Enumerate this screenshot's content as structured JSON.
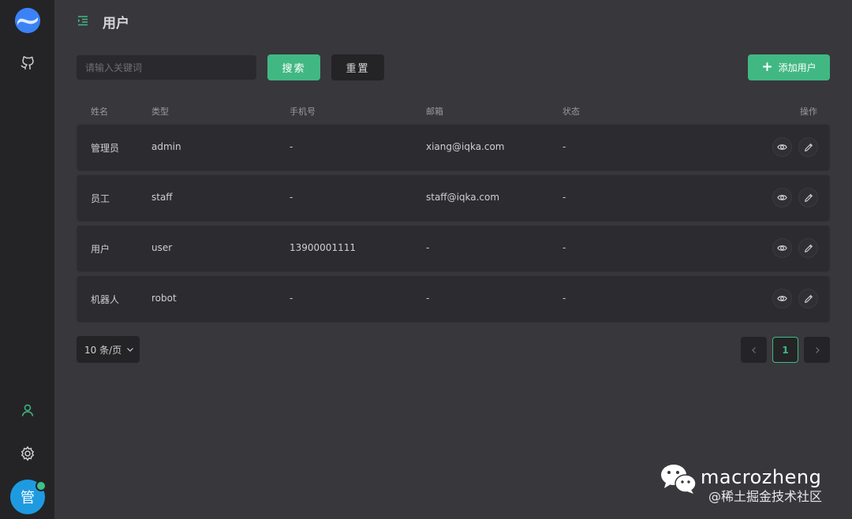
{
  "app": {
    "avatar_text": "管"
  },
  "sidebar": {
    "icons": [
      "logo-icon",
      "github-icon",
      "user-icon",
      "gear-icon"
    ]
  },
  "header": {
    "title": "用户"
  },
  "toolbar": {
    "search_placeholder": "请输入关键词",
    "search_label": "搜索",
    "reset_label": "重置",
    "add_label": "添加用户"
  },
  "table": {
    "columns": [
      "姓名",
      "类型",
      "手机号",
      "邮箱",
      "状态",
      "操作"
    ],
    "rows": [
      {
        "name": "管理员",
        "type": "admin",
        "phone": "-",
        "email": "xiang@iqka.com",
        "status": "-"
      },
      {
        "name": "员工",
        "type": "staff",
        "phone": "-",
        "email": "staff@iqka.com",
        "status": "-"
      },
      {
        "name": "用户",
        "type": "user",
        "phone": "13900001111",
        "email": "-",
        "status": "-"
      },
      {
        "name": "机器人",
        "type": "robot",
        "phone": "-",
        "email": "-",
        "status": "-"
      }
    ]
  },
  "pagination": {
    "page_size": "10 条/页",
    "current_page": "1"
  },
  "watermark": {
    "name": "macrozheng",
    "sub": "@稀土掘金技术社区"
  },
  "colors": {
    "accent": "#41b883",
    "background": "#38373c",
    "sidebar": "#242426",
    "row": "#2c2b30"
  }
}
